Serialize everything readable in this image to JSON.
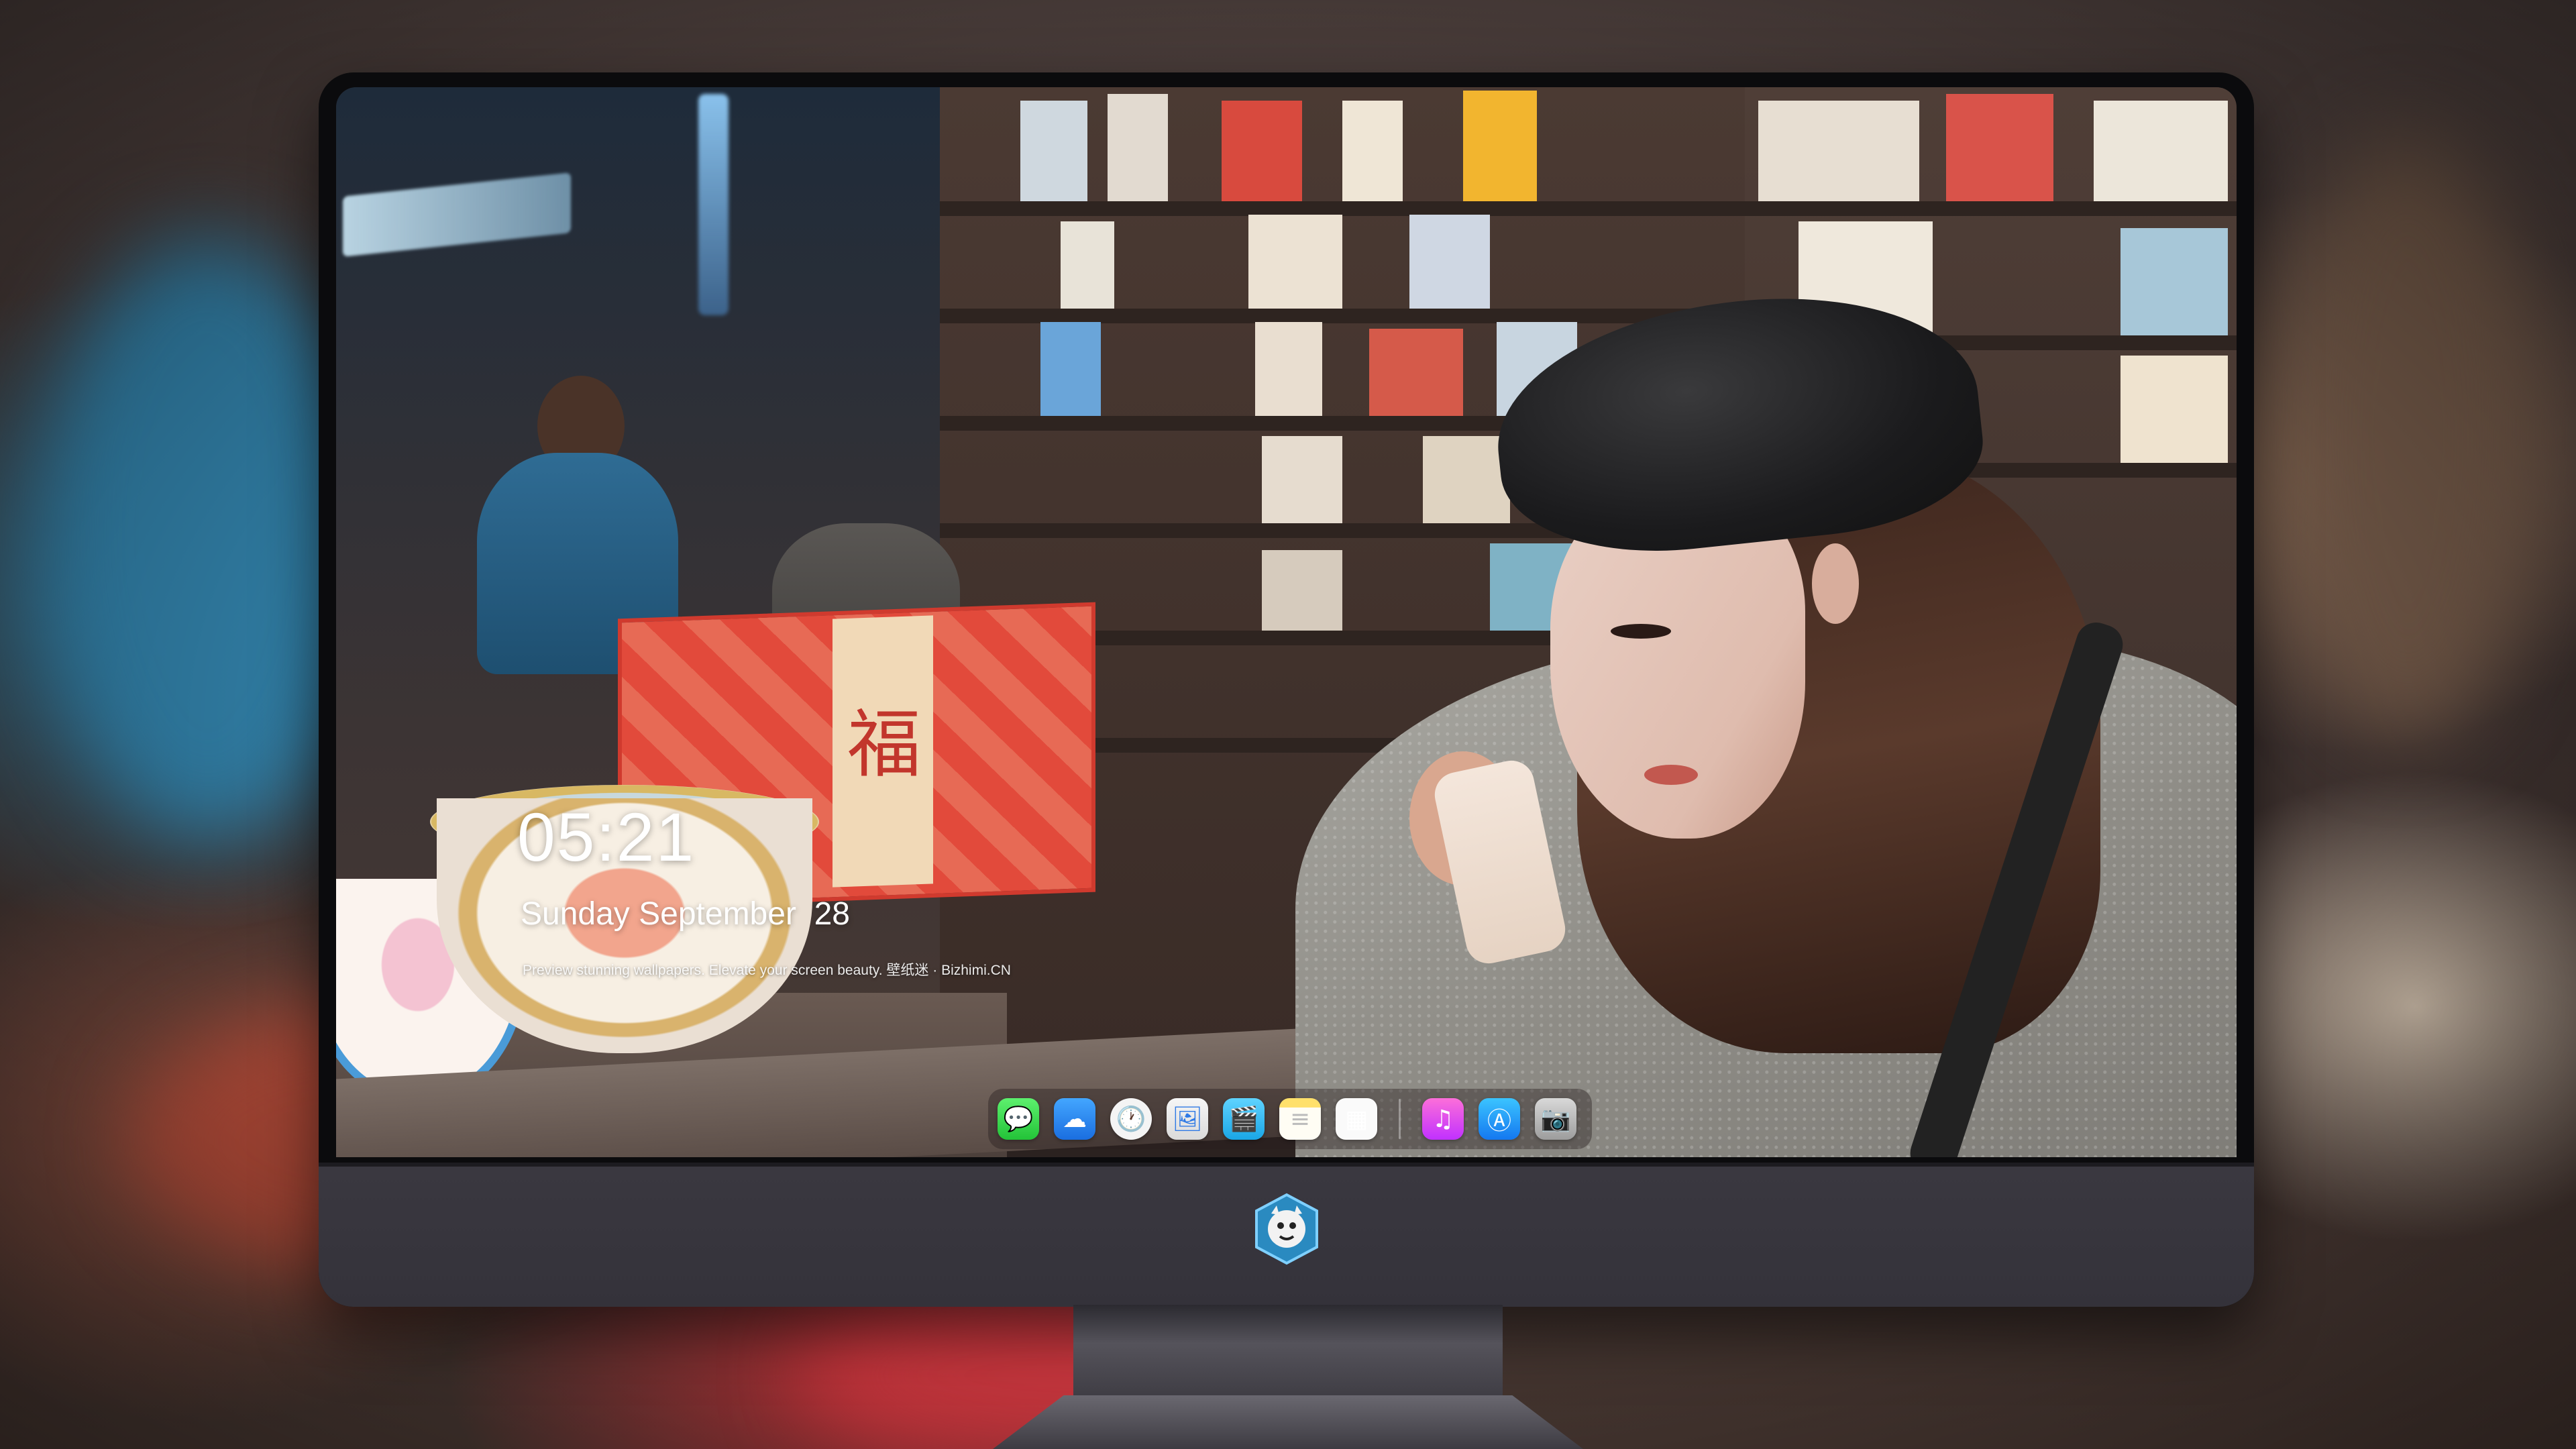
{
  "lockscreen": {
    "time": "05:21",
    "date": "Sunday September  28",
    "tagline": "Preview stunning wallpapers. Elevate your screen beauty. 壁纸迷 · Bizhimi.CN"
  },
  "wallpaper": {
    "box_character": "福"
  },
  "dock": {
    "apps": [
      {
        "name": "messages-icon",
        "glyph": "💬"
      },
      {
        "name": "weather-icon",
        "glyph": "☁"
      },
      {
        "name": "clock-icon",
        "glyph": "🕐"
      },
      {
        "name": "preview-icon",
        "glyph": "🖼"
      },
      {
        "name": "clips-icon",
        "glyph": "🎬"
      },
      {
        "name": "notes-icon",
        "glyph": "≡"
      },
      {
        "name": "collage-icon",
        "glyph": "▦"
      },
      {
        "name": "music-icon",
        "glyph": "♫"
      },
      {
        "name": "app-store-icon",
        "glyph": "Ⓐ"
      },
      {
        "name": "camera-icon",
        "glyph": "📷"
      }
    ]
  },
  "colors": {
    "monitor_bezel": "#0b0b0d",
    "monitor_chin": "#3a3840",
    "dock_background": "rgba(40,30,30,0.42)",
    "text": "#ffffff"
  }
}
